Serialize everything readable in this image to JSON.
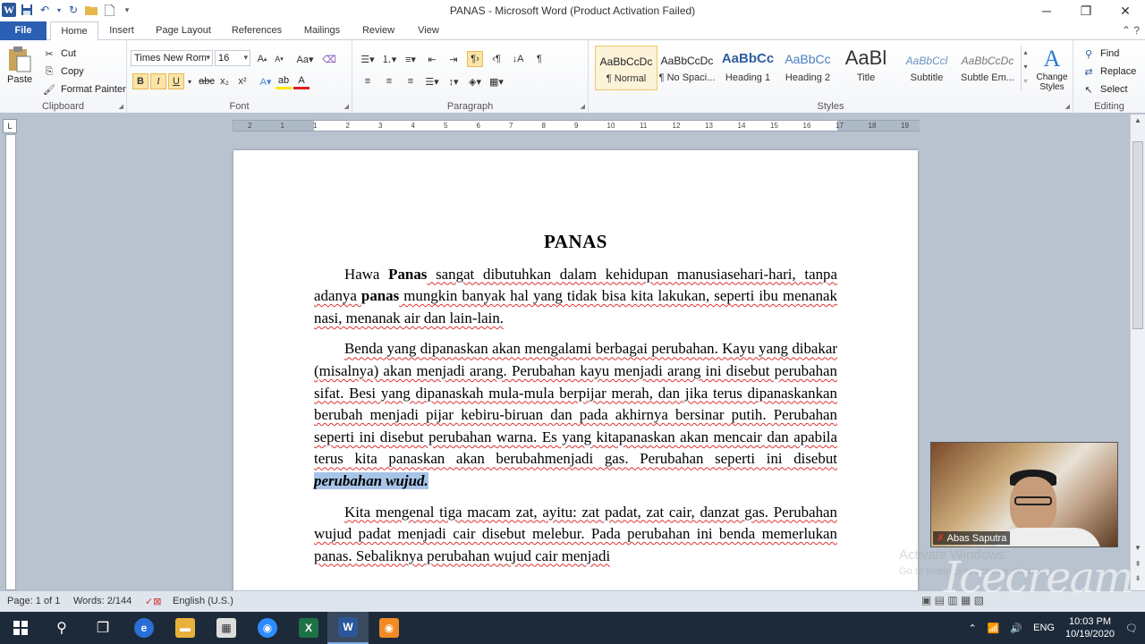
{
  "window": {
    "title": "PANAS - Microsoft Word (Product Activation Failed)",
    "app_icon": "W"
  },
  "tabs": [
    "File",
    "Home",
    "Insert",
    "Page Layout",
    "References",
    "Mailings",
    "Review",
    "View"
  ],
  "ribbon": {
    "clipboard": {
      "paste": "Paste",
      "cut": "Cut",
      "copy": "Copy",
      "format_painter": "Format Painter",
      "label": "Clipboard"
    },
    "font": {
      "name": "Times New Rom",
      "size": "16",
      "label": "Font"
    },
    "paragraph": {
      "label": "Paragraph"
    },
    "styles": {
      "label": "Styles",
      "items": [
        {
          "preview": "AaBbCcDc",
          "name": "¶ Normal"
        },
        {
          "preview": "AaBbCcDc",
          "name": "¶ No Spaci..."
        },
        {
          "preview": "AaBbCc",
          "name": "Heading 1"
        },
        {
          "preview": "AaBbCc",
          "name": "Heading 2"
        },
        {
          "preview": "AaBl",
          "name": "Title"
        },
        {
          "preview": "AaBbCcl",
          "name": "Subtitle"
        },
        {
          "preview": "AaBbCcDc",
          "name": "Subtle Em..."
        }
      ],
      "change_styles": "Change Styles"
    },
    "editing": {
      "find": "Find",
      "replace": "Replace",
      "select": "Select",
      "label": "Editing"
    }
  },
  "ruler_marks": [
    "2",
    "1",
    "1",
    "2",
    "3",
    "4",
    "5",
    "6",
    "7",
    "8",
    "9",
    "10",
    "11",
    "12",
    "13",
    "14",
    "15",
    "16",
    "17",
    "18",
    "19"
  ],
  "document": {
    "title": "PANAS",
    "p1": {
      "t1": "Hawa ",
      "b1": "Panas",
      "t2": " sangat dibutuhkan dalam kehidupan manusiasehari-hari, tanpa adanya ",
      "b2": "panas",
      "t3": " mungkin banyak hal yang tidak bisa kita lakukan, seperti ibu menanak nasi, menanak air dan lain-lain."
    },
    "p2": {
      "text": "Benda yang dipanaskan akan mengalami berbagai perubahan. Kayu yang dibakar (misalnya) akan menjadi arang. Perubahan kayu menjadi arang ini disebut perubahan sifat. Besi yang dipanaskah mula-mula berpijar merah, dan jika terus dipanaskankan berubah menjadi pijar kebiru-biruan dan pada akhirnya bersinar putih. Perubahan seperti ini disebut perubahan warna. Es yang kitapanaskan akan mencair dan apabila terus kita panaskan akan berubahmenjadi gas. Perubahan seperti ini disebut ",
      "highlight": "perubahan wujud."
    },
    "p3": "Kita mengenal tiga macam zat, ayitu: zat padat, zat cair, danzat gas. Perubahan wujud padat menjadi cair disebut melebur.  Pada perubahan ini benda memerlukan panas. Sebaliknya perubahan wujud cair menjadi"
  },
  "status": {
    "page": "Page: 1 of 1",
    "words": "Words: 2/144",
    "language": "English (U.S.)"
  },
  "webcam": {
    "name": "Abas Saputra"
  },
  "activate": {
    "line1": "Activate Windows",
    "line2": "Go to Settings to activate Windows."
  },
  "watermark": "Icecream",
  "taskbar": {
    "lang": "ENG",
    "time": "10:03 PM",
    "date": "10/19/2020"
  },
  "colors": {
    "file_tab": "#2b5fb3",
    "highlight": "#a7c4e8",
    "taskbar": "#1d2a3a"
  }
}
